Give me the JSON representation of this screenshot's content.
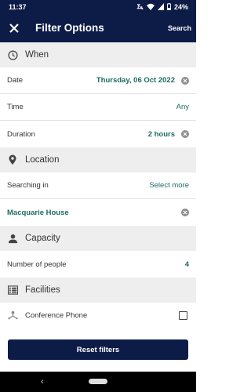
{
  "status_bar": {
    "time": "11:37",
    "battery": "24%"
  },
  "app_bar": {
    "title": "Filter Options",
    "search_label": "Search",
    "close_icon": "close-icon"
  },
  "sections": {
    "when": {
      "title": "When",
      "icon": "clock-icon",
      "date": {
        "label": "Date",
        "value": "Thursday, 06 Oct 2022"
      },
      "time": {
        "label": "Time",
        "value": "Any"
      },
      "duration": {
        "label": "Duration",
        "value": "2 hours"
      }
    },
    "location": {
      "title": "Location",
      "icon": "location-pin-icon",
      "searching_in": {
        "label": "Searching in",
        "value": "Select more"
      },
      "selected": {
        "name": "Macquarie House"
      }
    },
    "capacity": {
      "title": "Capacity",
      "icon": "person-icon",
      "people": {
        "label": "Number of people",
        "value": "4"
      }
    },
    "facilities": {
      "title": "Facilities",
      "icon": "facilities-icon",
      "items": [
        {
          "label": "Conference Phone",
          "icon": "conference-phone-icon",
          "checked": false
        }
      ]
    }
  },
  "footer": {
    "reset_label": "Reset filters"
  },
  "colors": {
    "primary": "#0d1b47",
    "accent": "#1c6b63",
    "section_bg": "#eeeeee"
  }
}
